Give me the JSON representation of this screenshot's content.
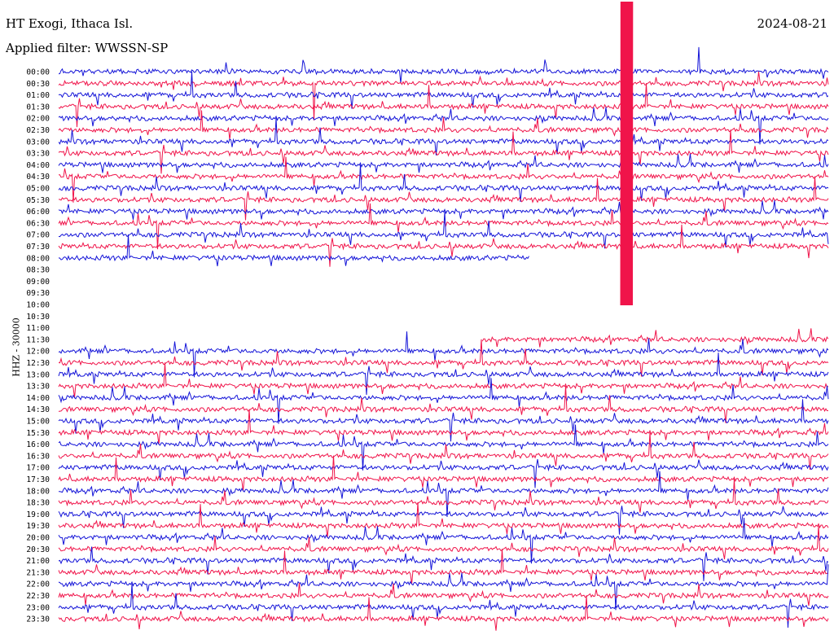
{
  "header": {
    "station": "HT Exogi, Ithaca Isl.",
    "filter": "Applied filter: WWSSN-SP",
    "date": "2024-08-21"
  },
  "colors": {
    "blue": "#1414d8",
    "red": "#f0144a"
  },
  "chart_data": {
    "type": "line",
    "title": "HT Exogi, Ithaca Isl.",
    "subtitle": "Applied filter: WWSSN-SP",
    "date": "2024-08-21",
    "ylabel": "HHZ - 30000",
    "rows": [
      "00:00",
      "00:30",
      "01:00",
      "01:30",
      "02:00",
      "02:30",
      "03:00",
      "03:30",
      "04:00",
      "04:30",
      "05:00",
      "05:30",
      "06:00",
      "06:30",
      "07:00",
      "07:30",
      "08:00",
      "08:30",
      "09:00",
      "09:30",
      "10:00",
      "10:30",
      "11:00",
      "11:30",
      "12:00",
      "12:30",
      "13:00",
      "13:30",
      "14:00",
      "14:30",
      "15:00",
      "15:30",
      "16:00",
      "16:30",
      "17:00",
      "17:30",
      "18:00",
      "18:30",
      "19:00",
      "19:30",
      "20:00",
      "20:30",
      "21:00",
      "21:30",
      "22:00",
      "22:30",
      "23:00",
      "23:30"
    ],
    "series_colors": [
      "blue",
      "red"
    ],
    "gap": {
      "from": "08:30",
      "to": "11:30"
    },
    "partial_row": "11:30",
    "partial_from_minute": 16.5
  }
}
